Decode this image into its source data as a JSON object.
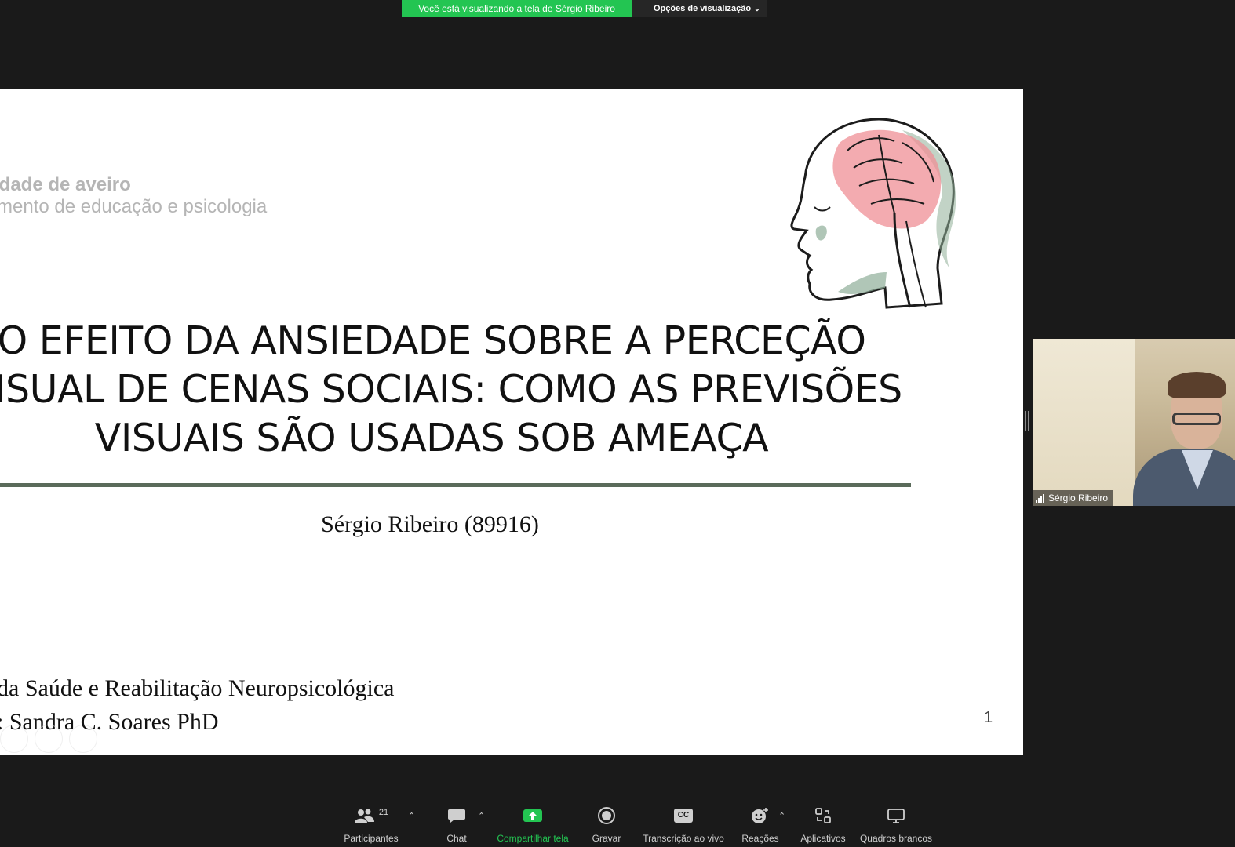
{
  "banner": {
    "viewing_text": "Você está visualizando a tela de Sérgio Ribeiro",
    "view_options_label": "Opções de visualização"
  },
  "slide": {
    "uni_line1": "idade de aveiro",
    "uni_line2": "mento de educação e psicologia",
    "title_lines": [
      "O EFEITO DA ANSIEDADE SOBRE A PERCEÇÃO",
      "VISUAL DE CENAS SOCIAIS: COMO AS PREVISÕES",
      "VISUAIS SÃO USADAS SOB AMEAÇA"
    ],
    "author": "Sérgio Ribeiro (89916)",
    "program": "da Saúde e Reabilitação Neuropsicológica",
    "advisor": ": Sandra C. Soares PhD",
    "page_number": "1"
  },
  "video": {
    "participant_name": "Sérgio Ribeiro"
  },
  "toolbar": {
    "participants_label": "Participantes",
    "participants_count": "21",
    "chat_label": "Chat",
    "share_label": "Compartilhar tela",
    "record_label": "Gravar",
    "transcription_label": "Transcrição ao vivo",
    "reactions_label": "Reações",
    "apps_label": "Aplicativos",
    "whiteboards_label": "Quadros brancos",
    "cc_text": "CC"
  },
  "colors": {
    "banner_green": "#23c552",
    "background": "#1a1a1a",
    "slide_rule": "#5a6b5a",
    "brain_pink": "#ef8f96",
    "face_green": "#8fae98"
  }
}
